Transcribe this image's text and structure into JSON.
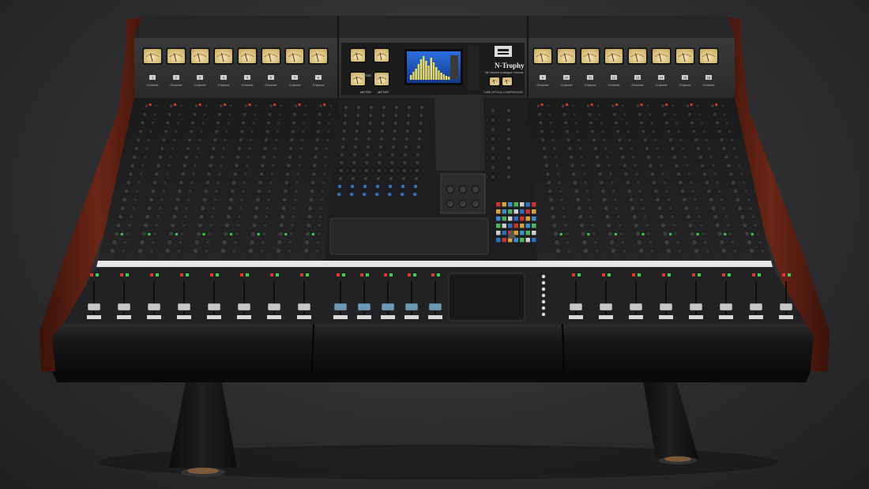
{
  "console": {
    "brand_name": "N-Trophy",
    "brand_subtitle": "Nil Discrete Analogue Console",
    "compressor_label": "TUBE OPTICAL COMPRESSOR",
    "meter_labels": [
      "METER",
      "METER",
      "METER",
      "METER"
    ],
    "channel_label": "Channel",
    "left_channel_numbers": [
      "1",
      "2",
      "3",
      "4",
      "5",
      "6",
      "7",
      "8"
    ],
    "right_channel_numbers": [
      "9",
      "10",
      "11",
      "12",
      "13",
      "14",
      "15",
      "16"
    ]
  },
  "colors": {
    "vu_face": "#e8d49a",
    "screen_bg": "#1d5bc4",
    "wood": "#5a1e12",
    "led_green": "#39d24a",
    "led_red": "#d83a2a"
  }
}
